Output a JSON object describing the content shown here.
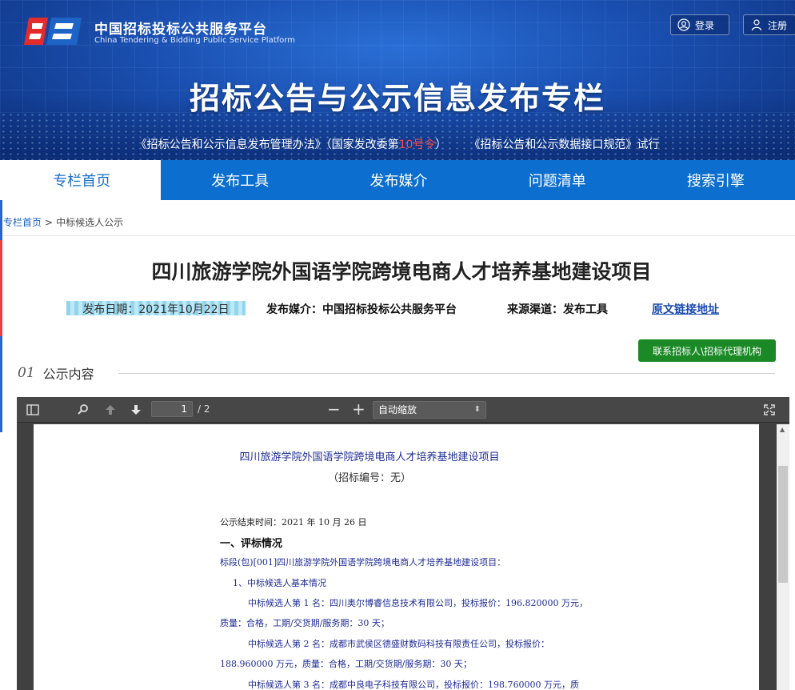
{
  "brand": {
    "name_cn": "中国招标投标公共服务平台",
    "name_en": "China Tendering & Bidding Public Service Platform"
  },
  "auth": {
    "login": "登录",
    "register": "注册"
  },
  "hero": {
    "title": "招标公告与公示信息发布专栏",
    "sub_a": "《招标公告和公示信息发布管理办法》（国家发改委第",
    "sub_red": "10号令",
    "sub_b": "）",
    "sub_c": "《招标公告和公示数据接口规范》试行"
  },
  "nav": {
    "tabs": [
      "专栏首页",
      "发布工具",
      "发布媒介",
      "问题清单",
      "搜索引擎"
    ]
  },
  "breadcrumb": {
    "home": "专栏首页",
    "sep": ">",
    "current": "中标候选人公示"
  },
  "doc": {
    "title": "四川旅游学院外国语学院跨境电商人才培养基地建设项目",
    "date": "发布日期：2021年10月22日",
    "media": "发布媒介：中国招标投标公共服务平台",
    "source": "来源渠道：发布工具",
    "link": "原文链接地址"
  },
  "contact_button": "联系招标人\\招标代理机构",
  "section": {
    "num": "01",
    "label": "公示内容"
  },
  "viewer": {
    "page_current": "1",
    "page_total": "/ 2",
    "zoom": "自动缩放",
    "icons": [
      "sidebar-toggle-icon",
      "search-icon",
      "previous-page-icon",
      "next-page-icon",
      "fullscreen-icon"
    ]
  },
  "pdf": {
    "title": "四川旅游学院外国语学院跨境电商人才培养基地建设项目",
    "code": "（招标编号：无）",
    "end_time": "公示结束时间：2021 年 10 月 26 日",
    "h1": "一、评标情况",
    "lot": "标段(包)[001]四川旅游学院外国语学院跨境电商人才培养基地建设项目：",
    "sub1": "1、中标候选人基本情况",
    "c1a": "中标候选人第 1 名：四川奥尔博睿信息技术有限公司，投标报价：196.820000 万元，",
    "c1b": "质量：合格，工期/交货期/服务期：30 天；",
    "c2a": "中标候选人第 2 名：成都市武侯区德盛财数码科技有限责任公司，投标报价：",
    "c2b": "188.960000 万元，质量：合格，工期/交货期/服务期：30 天；",
    "c3a": "中标候选人第 3 名：成都中良电子科技有限公司，投标报价：198.760000 万元，质"
  },
  "colors": {
    "nav_blue": "#0c6fcf",
    "active_text": "#1a6fc9",
    "contact_green": "#1b8a26",
    "pdf_text_blue": "#1f2c96"
  }
}
